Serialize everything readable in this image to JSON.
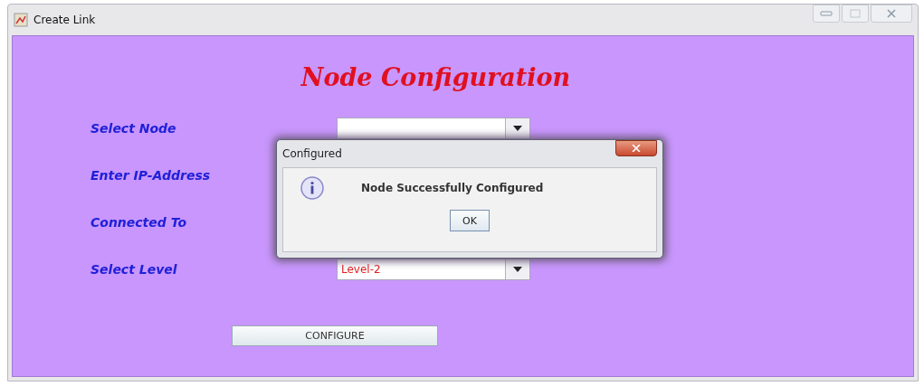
{
  "window": {
    "title": "Create Link"
  },
  "heading": "Node Configuration",
  "form": {
    "rows": [
      {
        "label": "Select Node",
        "kind": "combo"
      },
      {
        "label": "Enter IP-Address",
        "kind": "none"
      },
      {
        "label": "Connected To",
        "kind": "none"
      },
      {
        "label": "Select Level",
        "kind": "combo",
        "value": "Level-2"
      }
    ]
  },
  "configure_button": "CONFIGURE",
  "dialog": {
    "title": "Configured",
    "message": "Node Successfully Configured",
    "ok_button": "OK"
  }
}
